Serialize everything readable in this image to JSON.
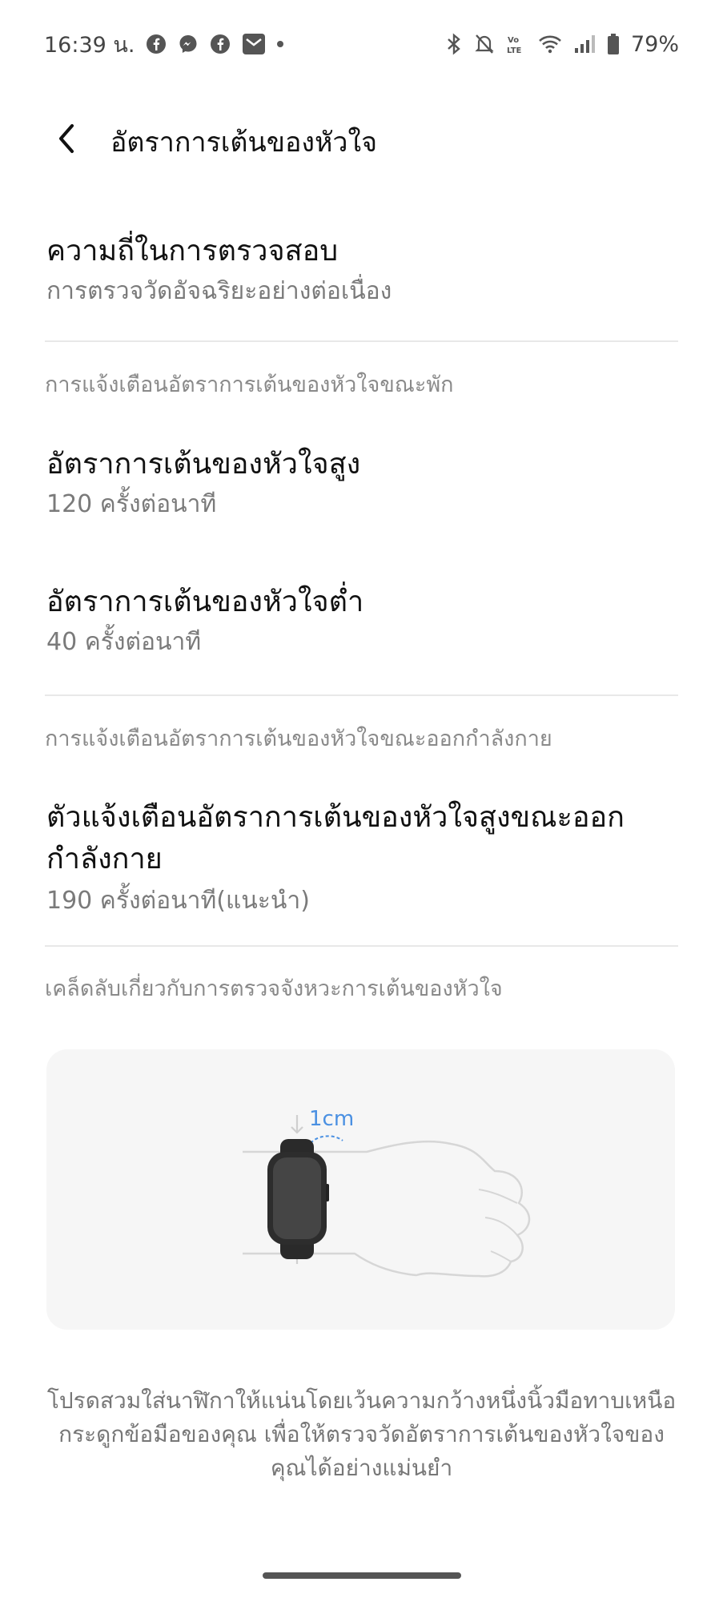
{
  "status_bar": {
    "time": "16:39 น.",
    "battery": "79%",
    "icons": [
      "facebook-icon",
      "messenger-icon",
      "facebook-icon",
      "mail-icon",
      "dot-icon",
      "bluetooth-icon",
      "mute-icon",
      "volte-icon",
      "wifi-icon",
      "signal-icon",
      "battery-icon"
    ]
  },
  "header": {
    "title": "อัตราการเต้นของหัวใจ"
  },
  "settings": {
    "frequency": {
      "title": "ความถี่ในการตรวจสอบ",
      "value": "การตรวจวัดอัจฉริยะอย่างต่อเนื่อง"
    },
    "rest_section": "การแจ้งเตือนอัตราการเต้นของหัวใจขณะพัก",
    "high": {
      "title": "อัตราการเต้นของหัวใจสูง",
      "value": "120 ครั้งต่อนาที"
    },
    "low": {
      "title": "อัตราการเต้นของหัวใจต่ำ",
      "value": "40 ครั้งต่อนาที"
    },
    "exercise_section": "การแจ้งเตือนอัตราการเต้นของหัวใจขณะออกกำลังกาย",
    "exercise_high": {
      "title": "ตัวแจ้งเตือนอัตราการเต้นของหัวใจสูงขณะออกกำลังกาย",
      "value": "190 ครั้งต่อนาที(แนะนำ)"
    },
    "tips_section": "เคล็ดลับเกี่ยวกับการตรวจจังหวะการเต้นของหัวใจ"
  },
  "illustration": {
    "measure_label": "1cm",
    "accent": "#4a90e2"
  },
  "help_text": "โปรดสวมใส่นาฬิกาให้แน่นโดยเว้นความกว้างหนึ่งนิ้วมือทาบเหนือกระดูกข้อมือของคุณ เพื่อให้ตรวจวัดอัตราการเต้นของหัวใจของคุณได้อย่างแม่นยำ"
}
